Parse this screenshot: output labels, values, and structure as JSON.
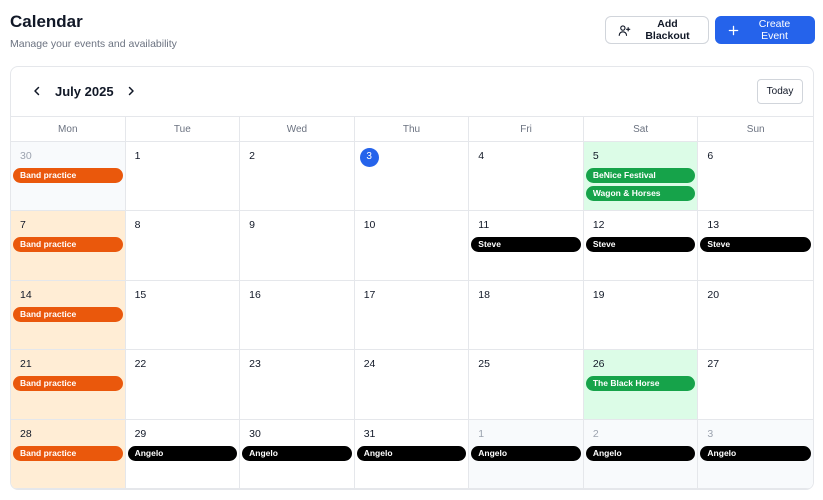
{
  "header": {
    "title": "Calendar",
    "subtitle": "Manage your events and availability",
    "add_blackout_label": "Add Blackout",
    "create_event_label": "Create Event"
  },
  "calendar": {
    "month_label": "July 2025",
    "today_label": "Today",
    "weekdays": [
      "Mon",
      "Tue",
      "Wed",
      "Thu",
      "Fri",
      "Sat",
      "Sun"
    ],
    "colors": {
      "accent": "#2563eb",
      "orange": "#ea580c",
      "green": "#16a34a",
      "black": "#000000",
      "monday_bg": "#ffedd5",
      "blackout_bg": "#dcfce7"
    },
    "days": [
      {
        "num": "30",
        "outside": true,
        "events": [
          {
            "label": "Band practice",
            "color": "orange"
          }
        ]
      },
      {
        "num": "1",
        "events": []
      },
      {
        "num": "2",
        "events": []
      },
      {
        "num": "3",
        "today": true,
        "events": []
      },
      {
        "num": "4",
        "events": []
      },
      {
        "num": "5",
        "blackout": true,
        "events": [
          {
            "label": "BeNice Festival",
            "color": "green"
          },
          {
            "label": "Wagon & Horses",
            "color": "green"
          }
        ]
      },
      {
        "num": "6",
        "events": []
      },
      {
        "num": "7",
        "mon": true,
        "events": [
          {
            "label": "Band practice",
            "color": "orange"
          }
        ]
      },
      {
        "num": "8",
        "events": []
      },
      {
        "num": "9",
        "events": []
      },
      {
        "num": "10",
        "events": []
      },
      {
        "num": "11",
        "events": [
          {
            "label": "Steve",
            "color": "black"
          }
        ]
      },
      {
        "num": "12",
        "events": [
          {
            "label": "Steve",
            "color": "black"
          }
        ]
      },
      {
        "num": "13",
        "events": [
          {
            "label": "Steve",
            "color": "black"
          }
        ]
      },
      {
        "num": "14",
        "mon": true,
        "events": [
          {
            "label": "Band practice",
            "color": "orange"
          }
        ]
      },
      {
        "num": "15",
        "events": []
      },
      {
        "num": "16",
        "events": []
      },
      {
        "num": "17",
        "events": []
      },
      {
        "num": "18",
        "events": []
      },
      {
        "num": "19",
        "events": []
      },
      {
        "num": "20",
        "events": []
      },
      {
        "num": "21",
        "mon": true,
        "events": [
          {
            "label": "Band practice",
            "color": "orange"
          }
        ]
      },
      {
        "num": "22",
        "events": []
      },
      {
        "num": "23",
        "events": []
      },
      {
        "num": "24",
        "events": []
      },
      {
        "num": "25",
        "events": []
      },
      {
        "num": "26",
        "blackout": true,
        "events": [
          {
            "label": "The Black Horse",
            "color": "green"
          }
        ]
      },
      {
        "num": "27",
        "events": []
      },
      {
        "num": "28",
        "mon": true,
        "events": [
          {
            "label": "Band practice",
            "color": "orange"
          }
        ]
      },
      {
        "num": "29",
        "events": [
          {
            "label": "Angelo",
            "color": "black"
          }
        ]
      },
      {
        "num": "30",
        "events": [
          {
            "label": "Angelo",
            "color": "black"
          }
        ]
      },
      {
        "num": "31",
        "events": [
          {
            "label": "Angelo",
            "color": "black"
          }
        ]
      },
      {
        "num": "1",
        "outside": true,
        "events": [
          {
            "label": "Angelo",
            "color": "black"
          }
        ]
      },
      {
        "num": "2",
        "outside": true,
        "events": [
          {
            "label": "Angelo",
            "color": "black"
          }
        ]
      },
      {
        "num": "3",
        "outside": true,
        "events": [
          {
            "label": "Angelo",
            "color": "black"
          }
        ]
      }
    ]
  },
  "icons": {
    "add_blackout": "user-plus-icon",
    "create_event": "plus-icon",
    "prev": "chevron-left-icon",
    "next": "chevron-right-icon"
  }
}
